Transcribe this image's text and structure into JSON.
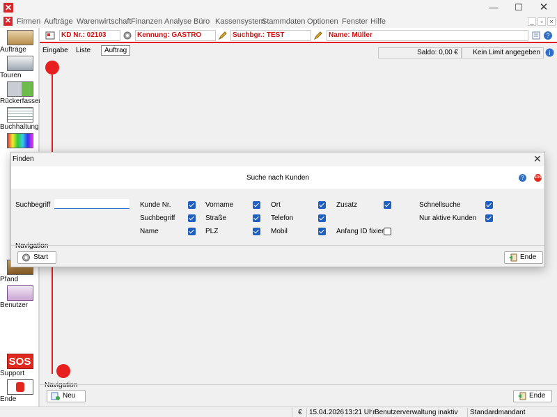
{
  "window": {
    "minimize": "—",
    "maximize": "☐",
    "close": "✕"
  },
  "menu": [
    "Firmen",
    "Aufträge",
    "Warenwirtschaft",
    "Finanzen",
    "Analyse",
    "Büro",
    "Kassensystem",
    "Stammdaten",
    "Optionen",
    "Fenster",
    "Hilfe"
  ],
  "toolbar": {
    "items": [
      {
        "label": "Aufträge",
        "icon": "orders-icon"
      },
      {
        "label": "Touren",
        "icon": "truck-icon"
      },
      {
        "label": "Rückerfassen",
        "icon": "truck-check-icon"
      },
      {
        "label": "Buchhaltung",
        "icon": "ledger-icon"
      },
      {
        "label": "Pfand",
        "icon": "deposit-icon"
      },
      {
        "label": "Benutzer",
        "icon": "users-icon"
      }
    ],
    "sos_text": "SOS",
    "support_label": "Support",
    "ende_label": "Ende"
  },
  "info": {
    "kd_nr": "KD Nr.: 02103",
    "kennung": "Kennung: GASTRO",
    "suchbgr": "Suchbgr.: TEST",
    "name": "Name: Müller"
  },
  "tabs": [
    "Eingabe",
    "Liste",
    "Auftrag"
  ],
  "saldo": "Saldo: 0,00 €",
  "limit": "Kein Limit angegeben",
  "navigation": {
    "label": "Navigation",
    "new_button": "Neu",
    "end_button": "Ende"
  },
  "statusbar": {
    "currency": "€",
    "date": "15.04.2026",
    "time": "13:21 Uhr",
    "user_admin": "Benutzerverwaltung inaktiv",
    "mandant": "Standardmandant"
  },
  "dialog": {
    "title": "Finden",
    "heading": "Suche nach Kunden",
    "search_label": "Suchbegriff",
    "search_value": "",
    "options": [
      {
        "label": "Kunde Nr.",
        "checked": true
      },
      {
        "label": "Vorname",
        "checked": true
      },
      {
        "label": "Ort",
        "checked": true
      },
      {
        "label": "Zusatz",
        "checked": true
      },
      {
        "label": "Schnellsuche",
        "checked": true
      },
      {
        "label": "Suchbegriff",
        "checked": true
      },
      {
        "label": "Straße",
        "checked": true
      },
      {
        "label": "Telefon",
        "checked": true
      },
      {
        "label": "Nur aktive Kunden",
        "checked": true
      },
      {
        "label": "Name",
        "checked": true
      },
      {
        "label": "PLZ",
        "checked": true
      },
      {
        "label": "Mobil",
        "checked": true
      },
      {
        "label": "Anfang ID fixiert",
        "checked": false
      }
    ],
    "navigation_label": "Navigation",
    "start_button": "Start",
    "end_button": "Ende",
    "help_icon": "?",
    "sos_icon": "SOS"
  }
}
